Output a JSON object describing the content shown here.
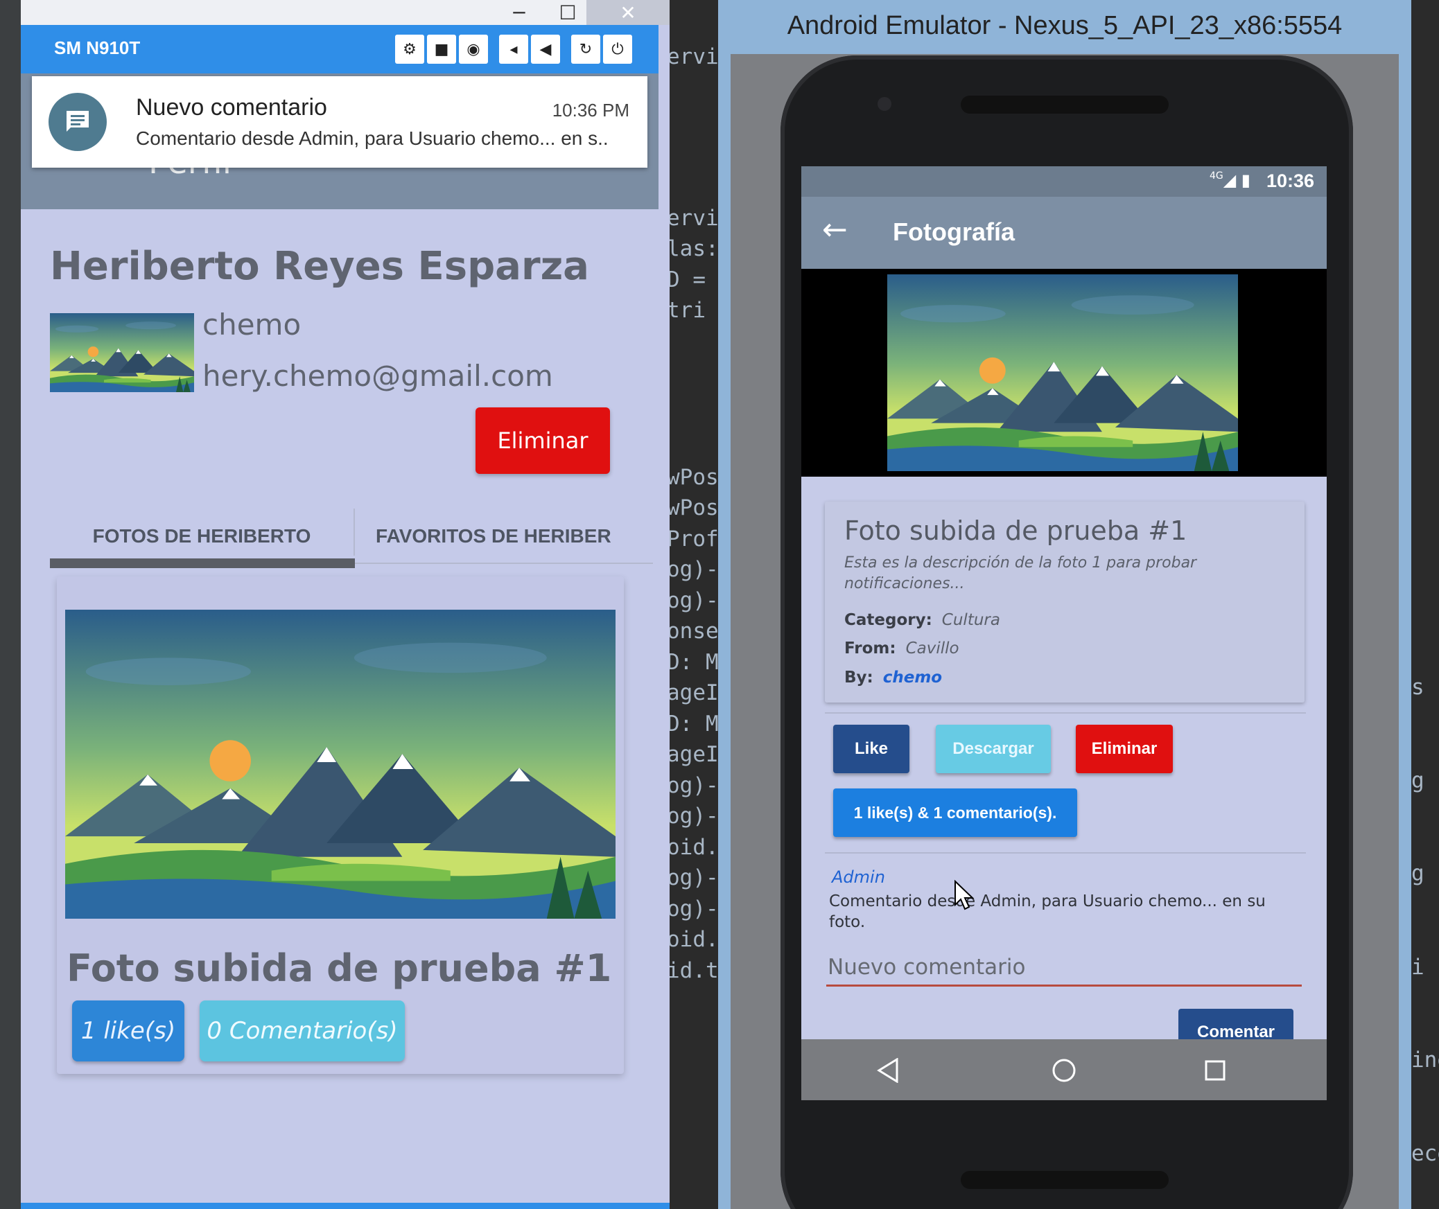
{
  "ide": {
    "code_snippets": [
      "ervice",
      "ervi",
      "las:",
      "D =",
      "tri",
      "wPos",
      "wPos",
      "Prof",
      "og)-",
      "og)-",
      "onse",
      "D: M",
      "ageI",
      "D: M",
      "ageI",
      "og)-",
      "og)-",
      "oid.",
      "og)-",
      "og)-",
      "oid.",
      "id.t"
    ],
    "right_snippets": [
      "s",
      "g",
      "g",
      "i",
      "ine",
      "ece"
    ]
  },
  "mirror_window": {
    "device_name": "SM N910T",
    "tools": [
      "settings-icon",
      "video-icon",
      "camera-icon",
      "volume-down-icon",
      "volume-up-icon",
      "rotate-icon",
      "power-icon"
    ],
    "notification": {
      "title": "Nuevo comentario",
      "time": "10:36 PM",
      "body": "Comentario desde Admin, para Usuario chemo... en s.."
    },
    "appbar_title": "Perfil",
    "profile": {
      "full_name": "Heriberto Reyes Esparza",
      "username": "chemo",
      "email": "hery.chemo@gmail.com",
      "delete_label": "Eliminar"
    },
    "tabs": [
      {
        "label": "FOTOS DE HERIBERTO",
        "active": true
      },
      {
        "label": "FAVORITOS DE HERIBER",
        "active": false
      }
    ],
    "photo_card": {
      "title": "Foto subida de prueba #1",
      "likes_label": "1 like(s)",
      "comments_label": "0 Comentario(s)"
    }
  },
  "emulator": {
    "window_title": "Android Emulator - Nexus_5_API_23_x86:5554",
    "status_time": "10:36",
    "status_network": "4G",
    "toolbar_title": "Fotografía",
    "photo": {
      "title": "Foto subida de prueba #1",
      "description": "Esta es la descripción de la foto 1 para probar notificaciones...",
      "category_label": "Category:",
      "category_value": "Cultura",
      "from_label": "From:",
      "from_value": "Cavillo",
      "by_label": "By:",
      "by_value": "chemo"
    },
    "buttons": {
      "like": "Like",
      "download": "Descargar",
      "delete": "Eliminar",
      "counts": "1 like(s) & 1 comentario(s)."
    },
    "comment": {
      "author": "Admin",
      "text": "Comentario desde Admin, para Usuario chemo... en su foto."
    },
    "new_comment_placeholder": "Nuevo comentario",
    "submit_label": "Comentar"
  },
  "colors": {
    "mirror_bar": "#2f8ee8",
    "danger": "#e01010",
    "primary_dark": "#254d8c",
    "info": "#67cbe4",
    "accent_blue": "#1c7fe0",
    "link": "#1f62d2",
    "emulator_frame": "#8fb4d8"
  }
}
